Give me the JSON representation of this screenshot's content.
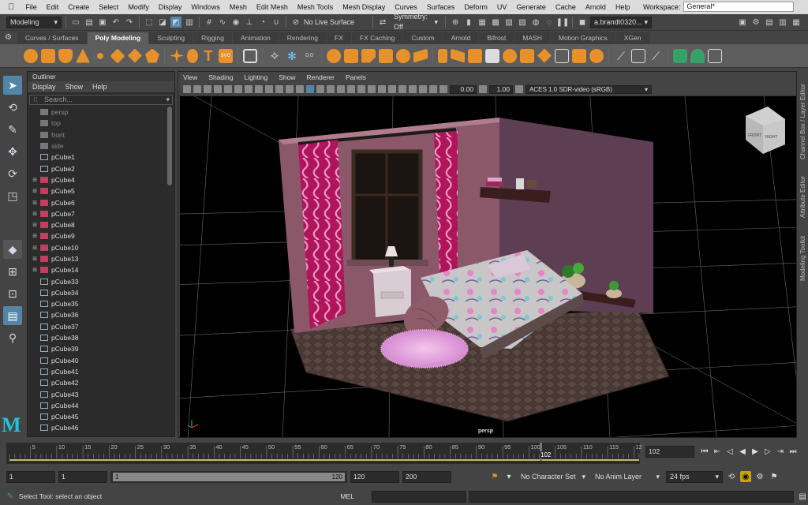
{
  "menubar": {
    "apple": "",
    "items": [
      "File",
      "Edit",
      "Create",
      "Select",
      "Modify",
      "Display",
      "Windows",
      "Mesh",
      "Edit Mesh",
      "Mesh Tools",
      "Mesh Display",
      "Curves",
      "Surfaces",
      "Deform",
      "UV",
      "Generate",
      "Cache",
      "Arnold",
      "Help"
    ],
    "workspace_label": "Workspace:",
    "workspace_value": "General*"
  },
  "statusline": {
    "menuset": "Modeling",
    "live_surface": "No Live Surface",
    "symmetry": "Symmetry: Off",
    "user": "a.brandt0320..."
  },
  "shelf_tabs": [
    "Curves / Surfaces",
    "Poly Modeling",
    "Sculpting",
    "Rigging",
    "Animation",
    "Rendering",
    "FX",
    "FX Caching",
    "Custom",
    "Arnold",
    "Bifrost",
    "MASH",
    "Motion Graphics",
    "XGen"
  ],
  "shelf_active": "Poly Modeling",
  "outliner": {
    "title": "Outliner",
    "menus": [
      "Display",
      "Show",
      "Help"
    ],
    "search_placeholder": "Search...",
    "items": [
      {
        "label": "persp",
        "dim": true,
        "expand": false
      },
      {
        "label": "top",
        "dim": true,
        "expand": false
      },
      {
        "label": "front",
        "dim": true,
        "expand": false
      },
      {
        "label": "side",
        "dim": true,
        "expand": false
      },
      {
        "label": "pCube1",
        "dim": false,
        "expand": false
      },
      {
        "label": "pCube2",
        "dim": false,
        "expand": false
      },
      {
        "label": "pCube4",
        "dim": false,
        "expand": true
      },
      {
        "label": "pCube5",
        "dim": false,
        "expand": true
      },
      {
        "label": "pCube6",
        "dim": false,
        "expand": true
      },
      {
        "label": "pCube7",
        "dim": false,
        "expand": true
      },
      {
        "label": "pCube8",
        "dim": false,
        "expand": true
      },
      {
        "label": "pCube9",
        "dim": false,
        "expand": true
      },
      {
        "label": "pCube10",
        "dim": false,
        "expand": true
      },
      {
        "label": "pCube13",
        "dim": false,
        "expand": true
      },
      {
        "label": "pCube14",
        "dim": false,
        "expand": true
      },
      {
        "label": "pCube33",
        "dim": false,
        "expand": false
      },
      {
        "label": "pCube34",
        "dim": false,
        "expand": false
      },
      {
        "label": "pCube35",
        "dim": false,
        "expand": false
      },
      {
        "label": "pCube36",
        "dim": false,
        "expand": false
      },
      {
        "label": "pCube37",
        "dim": false,
        "expand": false
      },
      {
        "label": "pCube38",
        "dim": false,
        "expand": false
      },
      {
        "label": "pCube39",
        "dim": false,
        "expand": false
      },
      {
        "label": "pCube40",
        "dim": false,
        "expand": false
      },
      {
        "label": "pCube41",
        "dim": false,
        "expand": false
      },
      {
        "label": "pCube42",
        "dim": false,
        "expand": false
      },
      {
        "label": "pCube43",
        "dim": false,
        "expand": false
      },
      {
        "label": "pCube44",
        "dim": false,
        "expand": false
      },
      {
        "label": "pCube45",
        "dim": false,
        "expand": false
      },
      {
        "label": "pCube46",
        "dim": false,
        "expand": false
      }
    ]
  },
  "viewport": {
    "menus": [
      "View",
      "Shading",
      "Lighting",
      "Show",
      "Renderer",
      "Panels"
    ],
    "exposure": "0.00",
    "gamma": "1.00",
    "colorspace": "ACES 1.0 SDR-video (sRGB)",
    "camera_label": "persp",
    "viewcube_front": "FRONT",
    "viewcube_right": "RIGHT"
  },
  "right_tabs": [
    "Channel Box / Layer Editor",
    "Attribute Editor",
    "Modeling Toolkit"
  ],
  "timeline": {
    "ticks": [
      "5",
      "10",
      "15",
      "20",
      "25",
      "30",
      "35",
      "40",
      "45",
      "50",
      "55",
      "60",
      "65",
      "70",
      "75",
      "80",
      "85",
      "90",
      "95",
      "100",
      "105",
      "110",
      "115",
      "12"
    ],
    "current_frame_marker": "102",
    "current_frame": "102"
  },
  "range": {
    "start": "1",
    "playback_start": "1",
    "slider_start": "1",
    "slider_end": "120",
    "playback_end": "120",
    "end": "200",
    "character_set": "No Character Set",
    "anim_layer": "No Anim Layer",
    "fps": "24 fps"
  },
  "cmdline": {
    "help": "Select Tool: select an object",
    "mel": "MEL"
  },
  "colors": {
    "accent": "#5285a6",
    "shelf_orange": "#e8902a",
    "timeline_yellow": "#c9b66b"
  }
}
